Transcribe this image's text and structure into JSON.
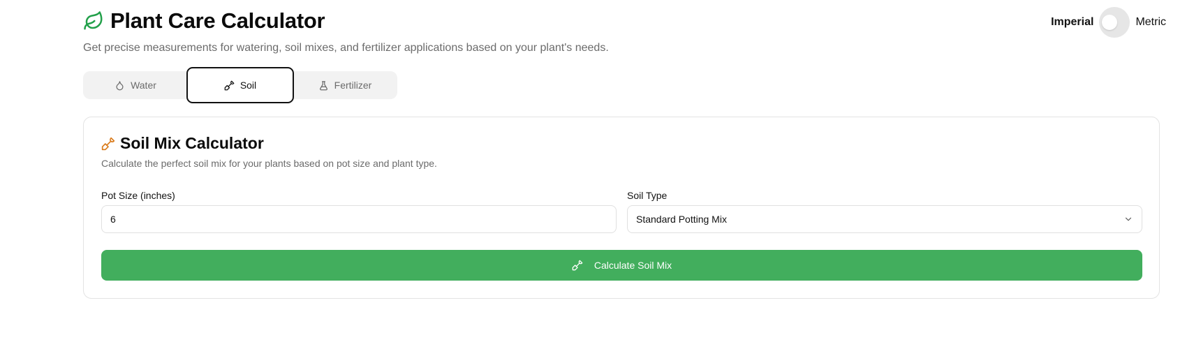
{
  "app": {
    "title": "Plant Care Calculator",
    "subtitle": "Get precise measurements for watering, soil mixes, and fertilizer applications based on your plant's needs."
  },
  "units": {
    "imperial_label": "Imperial",
    "metric_label": "Metric",
    "selected": "Imperial"
  },
  "tabs": [
    {
      "label": "Water",
      "icon": "droplet-icon",
      "active": false
    },
    {
      "label": "Soil",
      "icon": "shovel-icon",
      "active": true
    },
    {
      "label": "Fertilizer",
      "icon": "flask-icon",
      "active": false
    }
  ],
  "soil_card": {
    "title": "Soil Mix Calculator",
    "description": "Calculate the perfect soil mix for your plants based on pot size and plant type.",
    "pot_size": {
      "label": "Pot Size (inches)",
      "value": "6"
    },
    "soil_type": {
      "label": "Soil Type",
      "value": "Standard Potting Mix"
    },
    "button_label": "Calculate Soil Mix"
  },
  "colors": {
    "brand_green": "#22a04a",
    "button_green": "#42ae5d",
    "soil_icon_orange": "#d97a1a"
  }
}
